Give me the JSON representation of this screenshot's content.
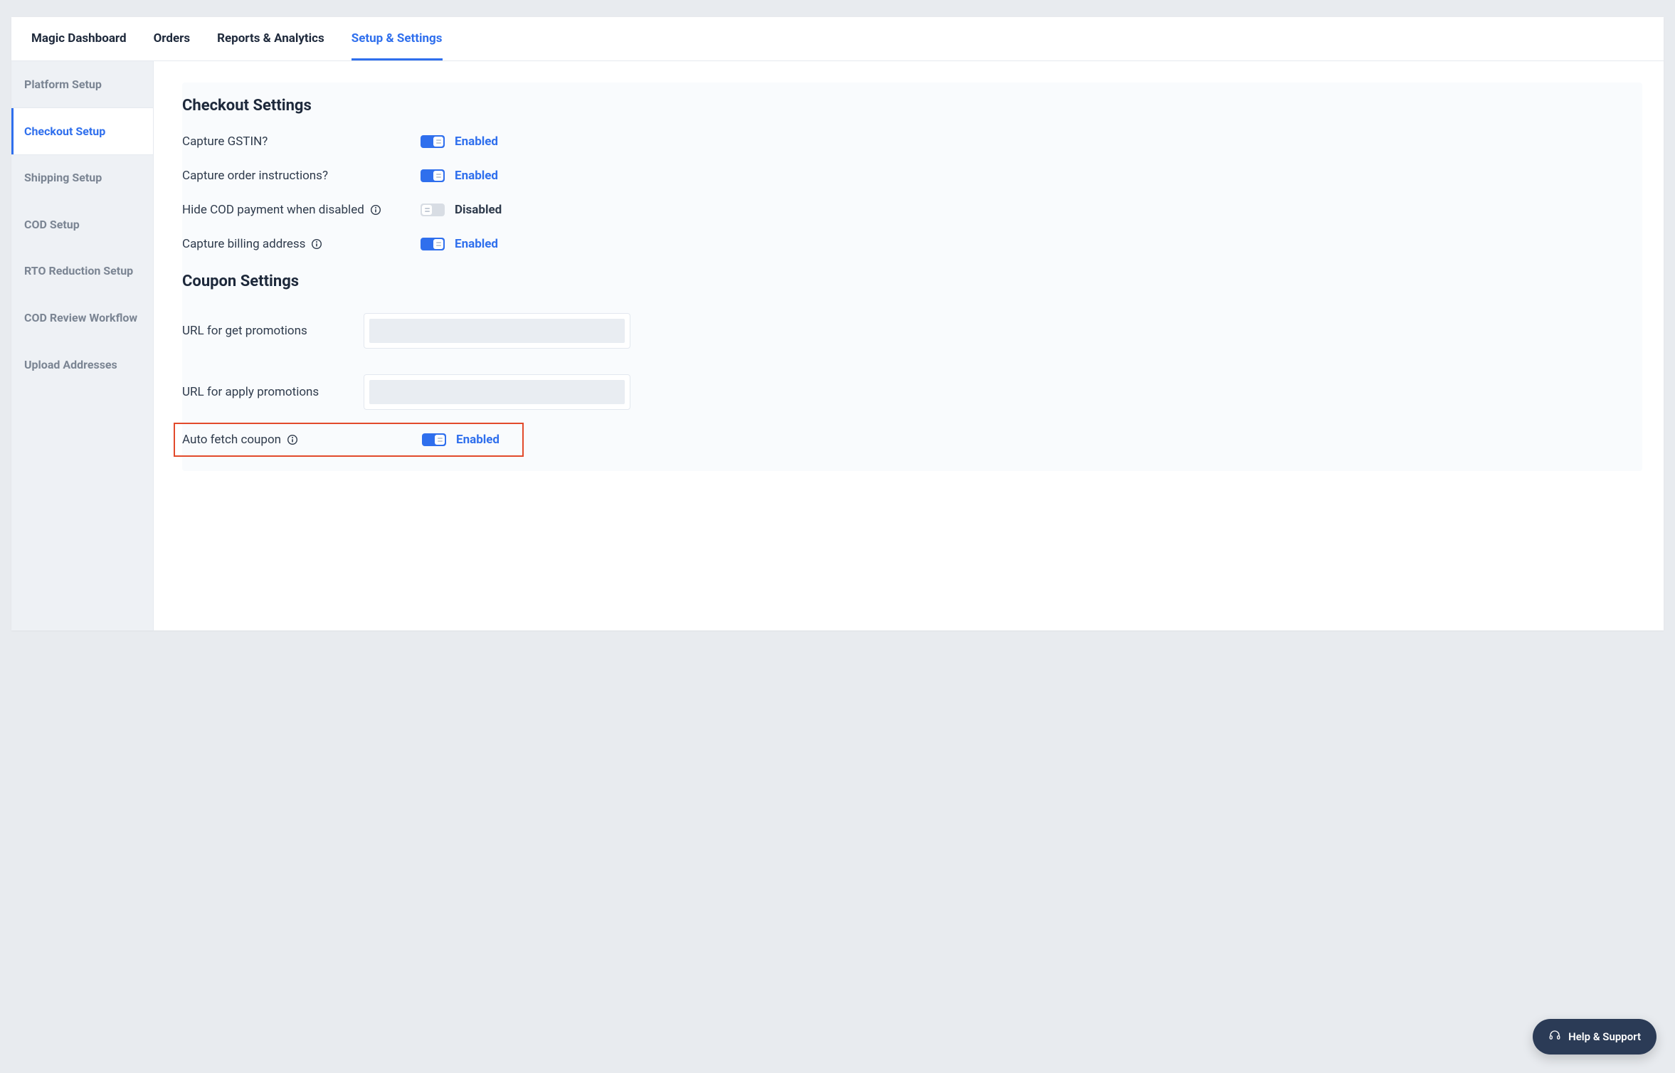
{
  "topnav": {
    "tabs": [
      {
        "label": "Magic Dashboard",
        "active": false
      },
      {
        "label": "Orders",
        "active": false
      },
      {
        "label": "Reports & Analytics",
        "active": false
      },
      {
        "label": "Setup & Settings",
        "active": true
      }
    ]
  },
  "sidebar": {
    "items": [
      {
        "label": "Platform Setup",
        "active": false
      },
      {
        "label": "Checkout Setup",
        "active": true
      },
      {
        "label": "Shipping Setup",
        "active": false
      },
      {
        "label": "COD Setup",
        "active": false
      },
      {
        "label": "RTO Reduction Setup",
        "active": false
      },
      {
        "label": "COD Review Workflow",
        "active": false
      },
      {
        "label": "Upload Addresses",
        "active": false
      }
    ]
  },
  "checkout": {
    "title": "Checkout Settings",
    "rows": [
      {
        "label": "Capture GSTIN?",
        "info": false,
        "enabled": true,
        "status": "Enabled"
      },
      {
        "label": "Capture order instructions?",
        "info": false,
        "enabled": true,
        "status": "Enabled"
      },
      {
        "label": "Hide COD payment when disabled",
        "info": true,
        "enabled": false,
        "status": "Disabled"
      },
      {
        "label": "Capture billing address",
        "info": true,
        "enabled": true,
        "status": "Enabled"
      }
    ]
  },
  "coupon": {
    "title": "Coupon Settings",
    "urls": [
      {
        "label": "URL for get promotions",
        "value": ""
      },
      {
        "label": "URL for apply promotions",
        "value": ""
      }
    ],
    "autofetch": {
      "label": "Auto fetch coupon",
      "info": true,
      "enabled": true,
      "status": "Enabled"
    }
  },
  "help": {
    "label": "Help & Support"
  }
}
